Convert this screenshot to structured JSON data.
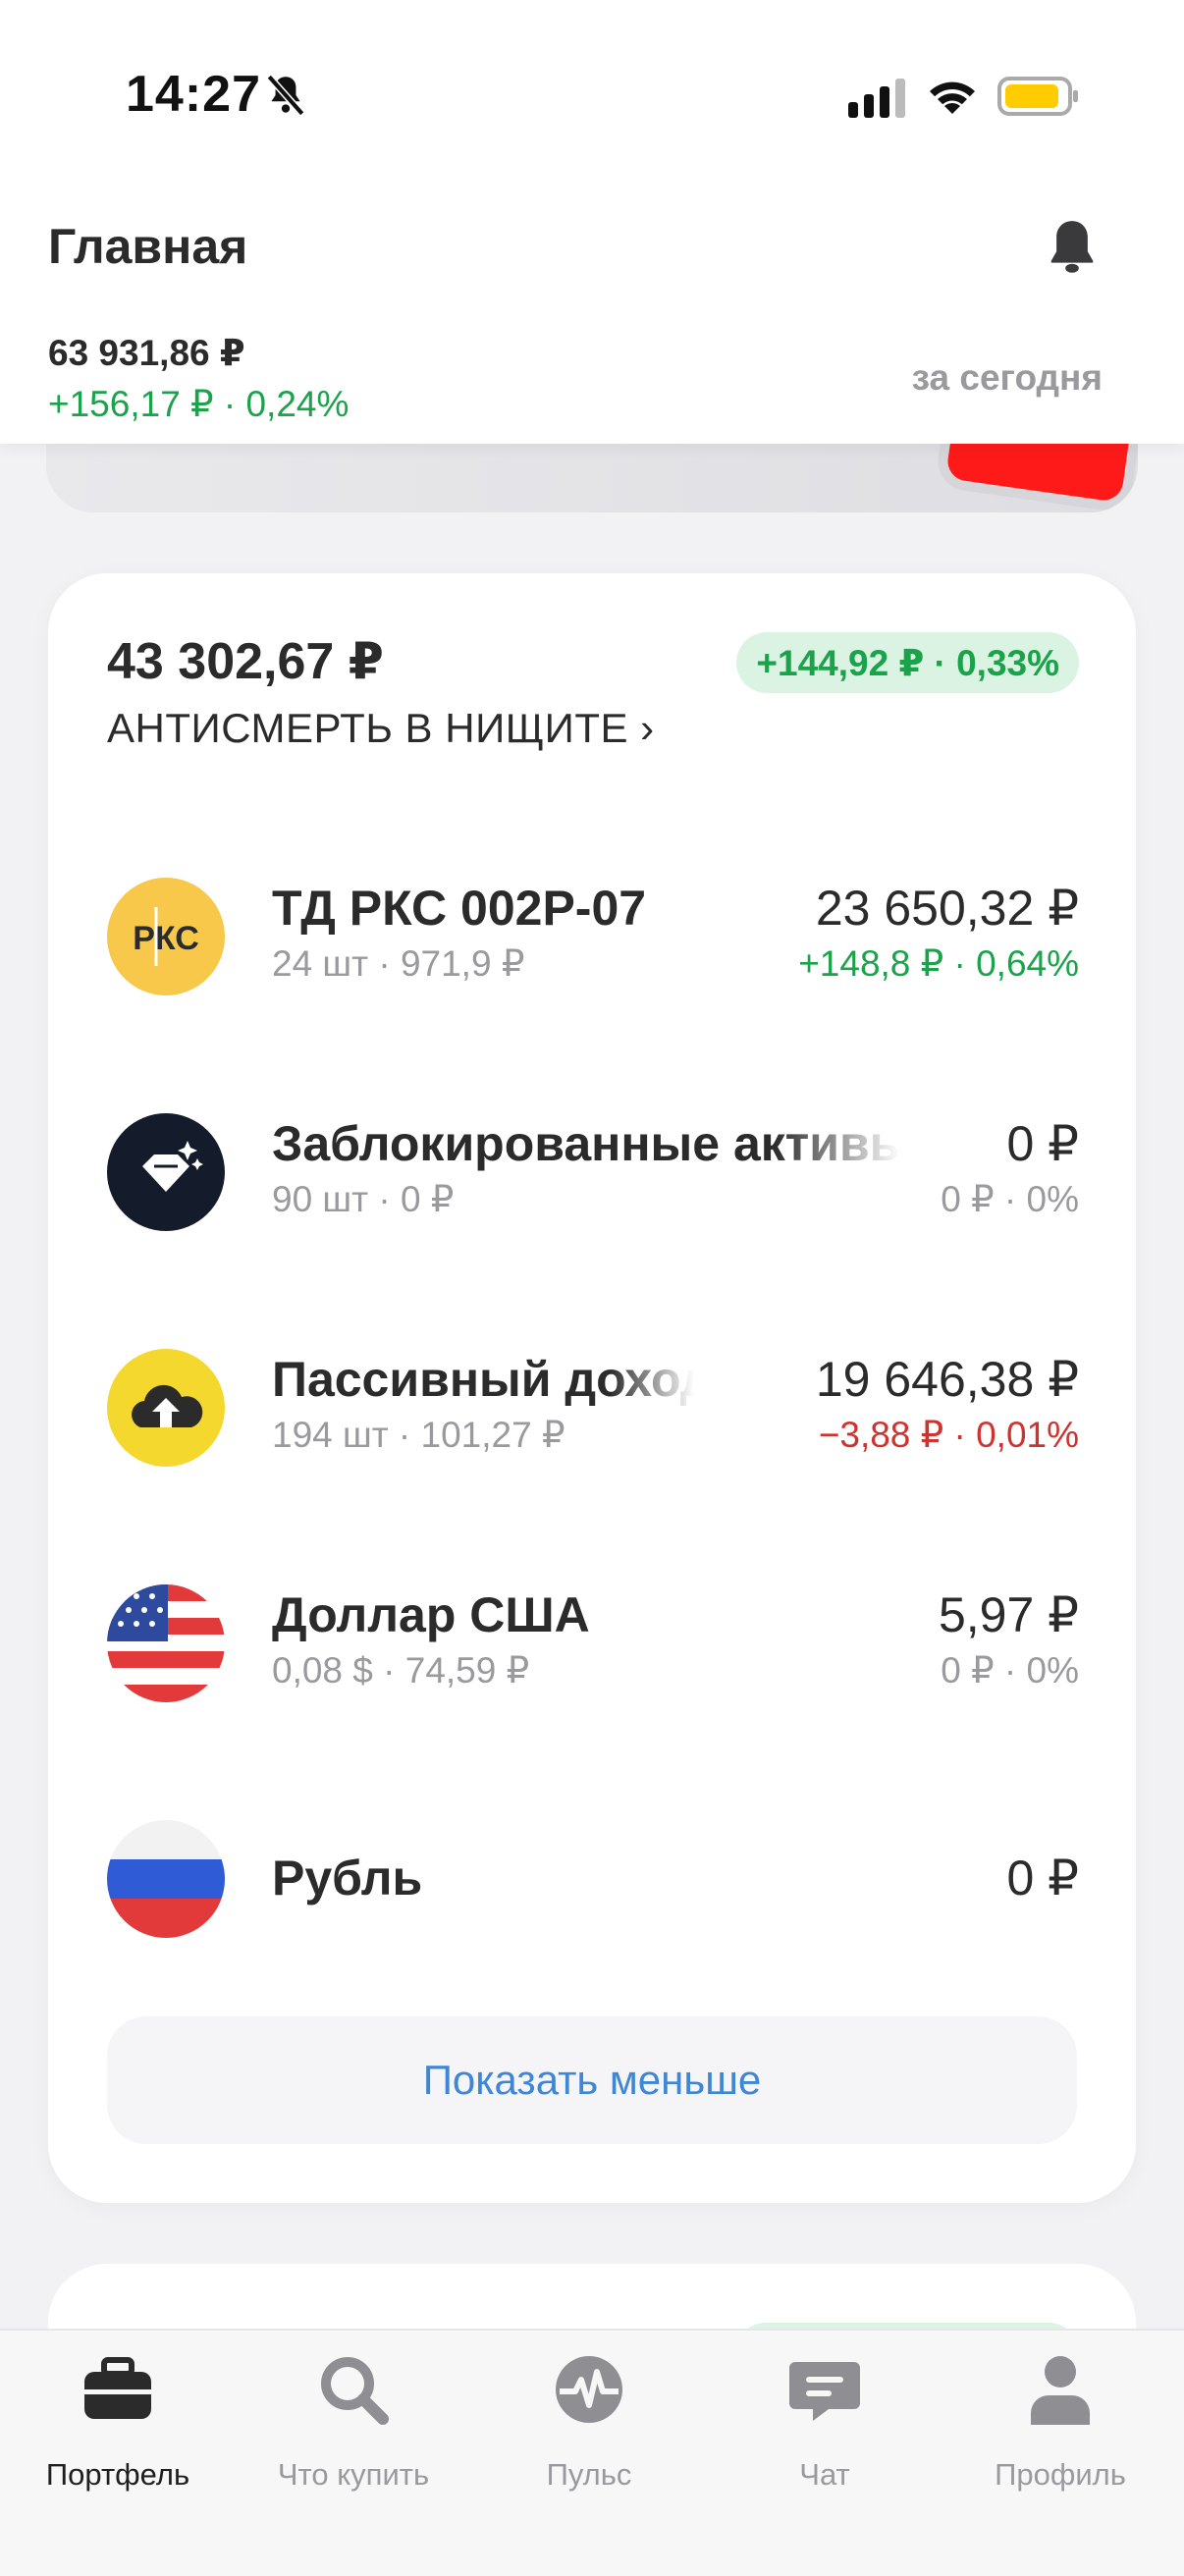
{
  "status_bar": {
    "time": "14:27"
  },
  "header": {
    "title": "Главная",
    "total": "63 931,86 ₽",
    "total_change": "+156,17 ₽ · 0,24%",
    "period": "за сегодня"
  },
  "portfolio": {
    "value": "43 302,67 ₽",
    "change": "+144,92 ₽ · 0,33%",
    "name": "АНТИСМЕРТЬ В НИЩИТЕ ›",
    "items": [
      {
        "logo_text": "РКС",
        "name": "ТД РКС 002Р-07",
        "sub": "24 шт · 971,9 ₽",
        "value": "23 650,32 ₽",
        "change": "+148,8 ₽ · 0,64%"
      },
      {
        "name": "Заблокированные активы",
        "sub": "90 шт · 0 ₽",
        "value": "0 ₽",
        "change": "0 ₽ · 0%"
      },
      {
        "name": "Пассивный доход",
        "sub": "194 шт · 101,27 ₽",
        "value": "19 646,38 ₽",
        "change": "−3,88 ₽ · 0,01%"
      },
      {
        "name": "Доллар США",
        "sub": "0,08 $ · 74,59 ₽",
        "value": "5,97 ₽",
        "change": "0 ₽ · 0%"
      },
      {
        "name": "Рубль",
        "value": "0 ₽"
      }
    ],
    "show_less": "Показать меньше"
  },
  "tabs": [
    {
      "label": "Портфель",
      "icon": "briefcase-icon",
      "active": true
    },
    {
      "label": "Что купить",
      "icon": "search-icon"
    },
    {
      "label": "Пульс",
      "icon": "pulse-icon"
    },
    {
      "label": "Чат",
      "icon": "chat-icon"
    },
    {
      "label": "Профиль",
      "icon": "profile-icon"
    }
  ],
  "colors": {
    "positive": "#1aa34a",
    "negative": "#d0332f",
    "link": "#3f86d4",
    "muted": "#9a9a9e"
  }
}
